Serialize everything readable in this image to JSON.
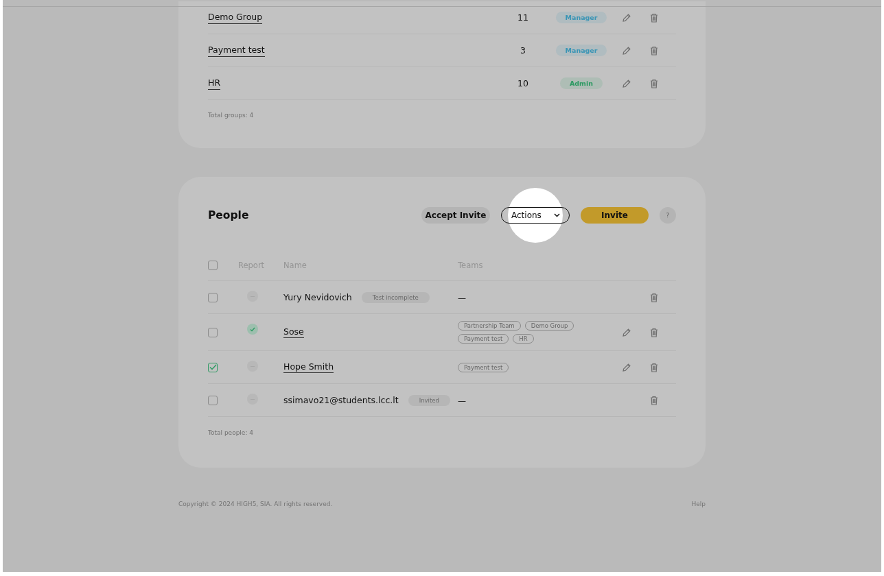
{
  "groups": {
    "rows": [
      {
        "name": "Demo Group",
        "members": "11",
        "role": "Manager",
        "color": "#3a95b5"
      },
      {
        "name": "Payment test",
        "members": "3",
        "role": "Manager",
        "color": "#3a95b5"
      },
      {
        "name": "HR",
        "members": "10",
        "role": "Admin",
        "color": "#2e9a63"
      }
    ],
    "total": "Total groups: 4"
  },
  "people": {
    "title": "People",
    "buttons": [
      {
        "label": "Accept Invite",
        "kind": "secondary"
      },
      {
        "label": "Actions",
        "kind": "dropdown",
        "highlighted": true
      },
      {
        "label": "Invite",
        "kind": "primary"
      },
      {
        "label": "?",
        "kind": "help"
      }
    ],
    "select_all": {
      "checked": false
    },
    "columns": [
      "Report",
      "Name",
      "Teams"
    ],
    "rows": [
      {
        "checked": false,
        "report_done": false,
        "name": "Yury Nevidovich",
        "linked": false,
        "status": "Test incomplete",
        "teams": [],
        "no_teams": "—",
        "editable": false
      },
      {
        "checked": false,
        "report_done": true,
        "name": "Sose",
        "linked": true,
        "teams": [
          "Partnership Team",
          "Demo Group",
          "Payment test",
          "HR"
        ],
        "editable": true
      },
      {
        "checked": true,
        "report_done": false,
        "name": "Hope Smith",
        "linked": true,
        "teams": [
          "Payment test"
        ],
        "editable": true
      },
      {
        "checked": false,
        "report_done": false,
        "name": "ssimavo21@students.lcc.lt",
        "linked": false,
        "status": "Invited",
        "teams": [],
        "no_teams": "—",
        "editable": false
      }
    ],
    "total": "Total people: 4"
  },
  "footer": {
    "copyright": "Copyright © 2024 HIGH5, SIA. All rights reserved.",
    "help": "Help"
  }
}
